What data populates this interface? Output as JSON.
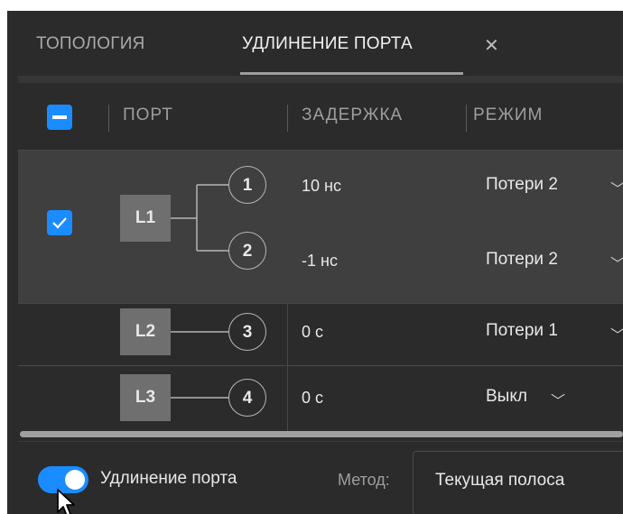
{
  "tabs": [
    {
      "label": "ТОПОЛОГИЯ",
      "active": false
    },
    {
      "label": "УДЛИНЕНИЕ ПОРТА",
      "active": true
    }
  ],
  "table": {
    "columns": [
      "ПОРТ",
      "ЗАДЕРЖКА",
      "РЕЖИМ"
    ],
    "groups": [
      {
        "line": "L1",
        "selected": true,
        "ports": [
          {
            "port": "1",
            "delay": "10 нс",
            "mode": "Потери 2"
          },
          {
            "port": "2",
            "delay": "-1 нс",
            "mode": "Потери 2"
          }
        ]
      },
      {
        "line": "L2",
        "selected": false,
        "ports": [
          {
            "port": "3",
            "delay": "0 с",
            "mode": "Потери 1"
          }
        ]
      },
      {
        "line": "L3",
        "selected": false,
        "ports": [
          {
            "port": "4",
            "delay": "0 с",
            "mode": "Выкл"
          }
        ]
      }
    ]
  },
  "footer": {
    "toggle_label": "Удлинение порта",
    "toggle_on": true,
    "method_label": "Метод:",
    "method_value": "Текущая полоса"
  },
  "colors": {
    "accent": "#1a8cff",
    "background": "#2b2b2b",
    "selected_row": "#3f3f3f"
  },
  "icons": {
    "tab_close": "close-icon",
    "mode_dropdown": "chevron-down-icon",
    "pointer": "mouse-cursor-icon"
  }
}
